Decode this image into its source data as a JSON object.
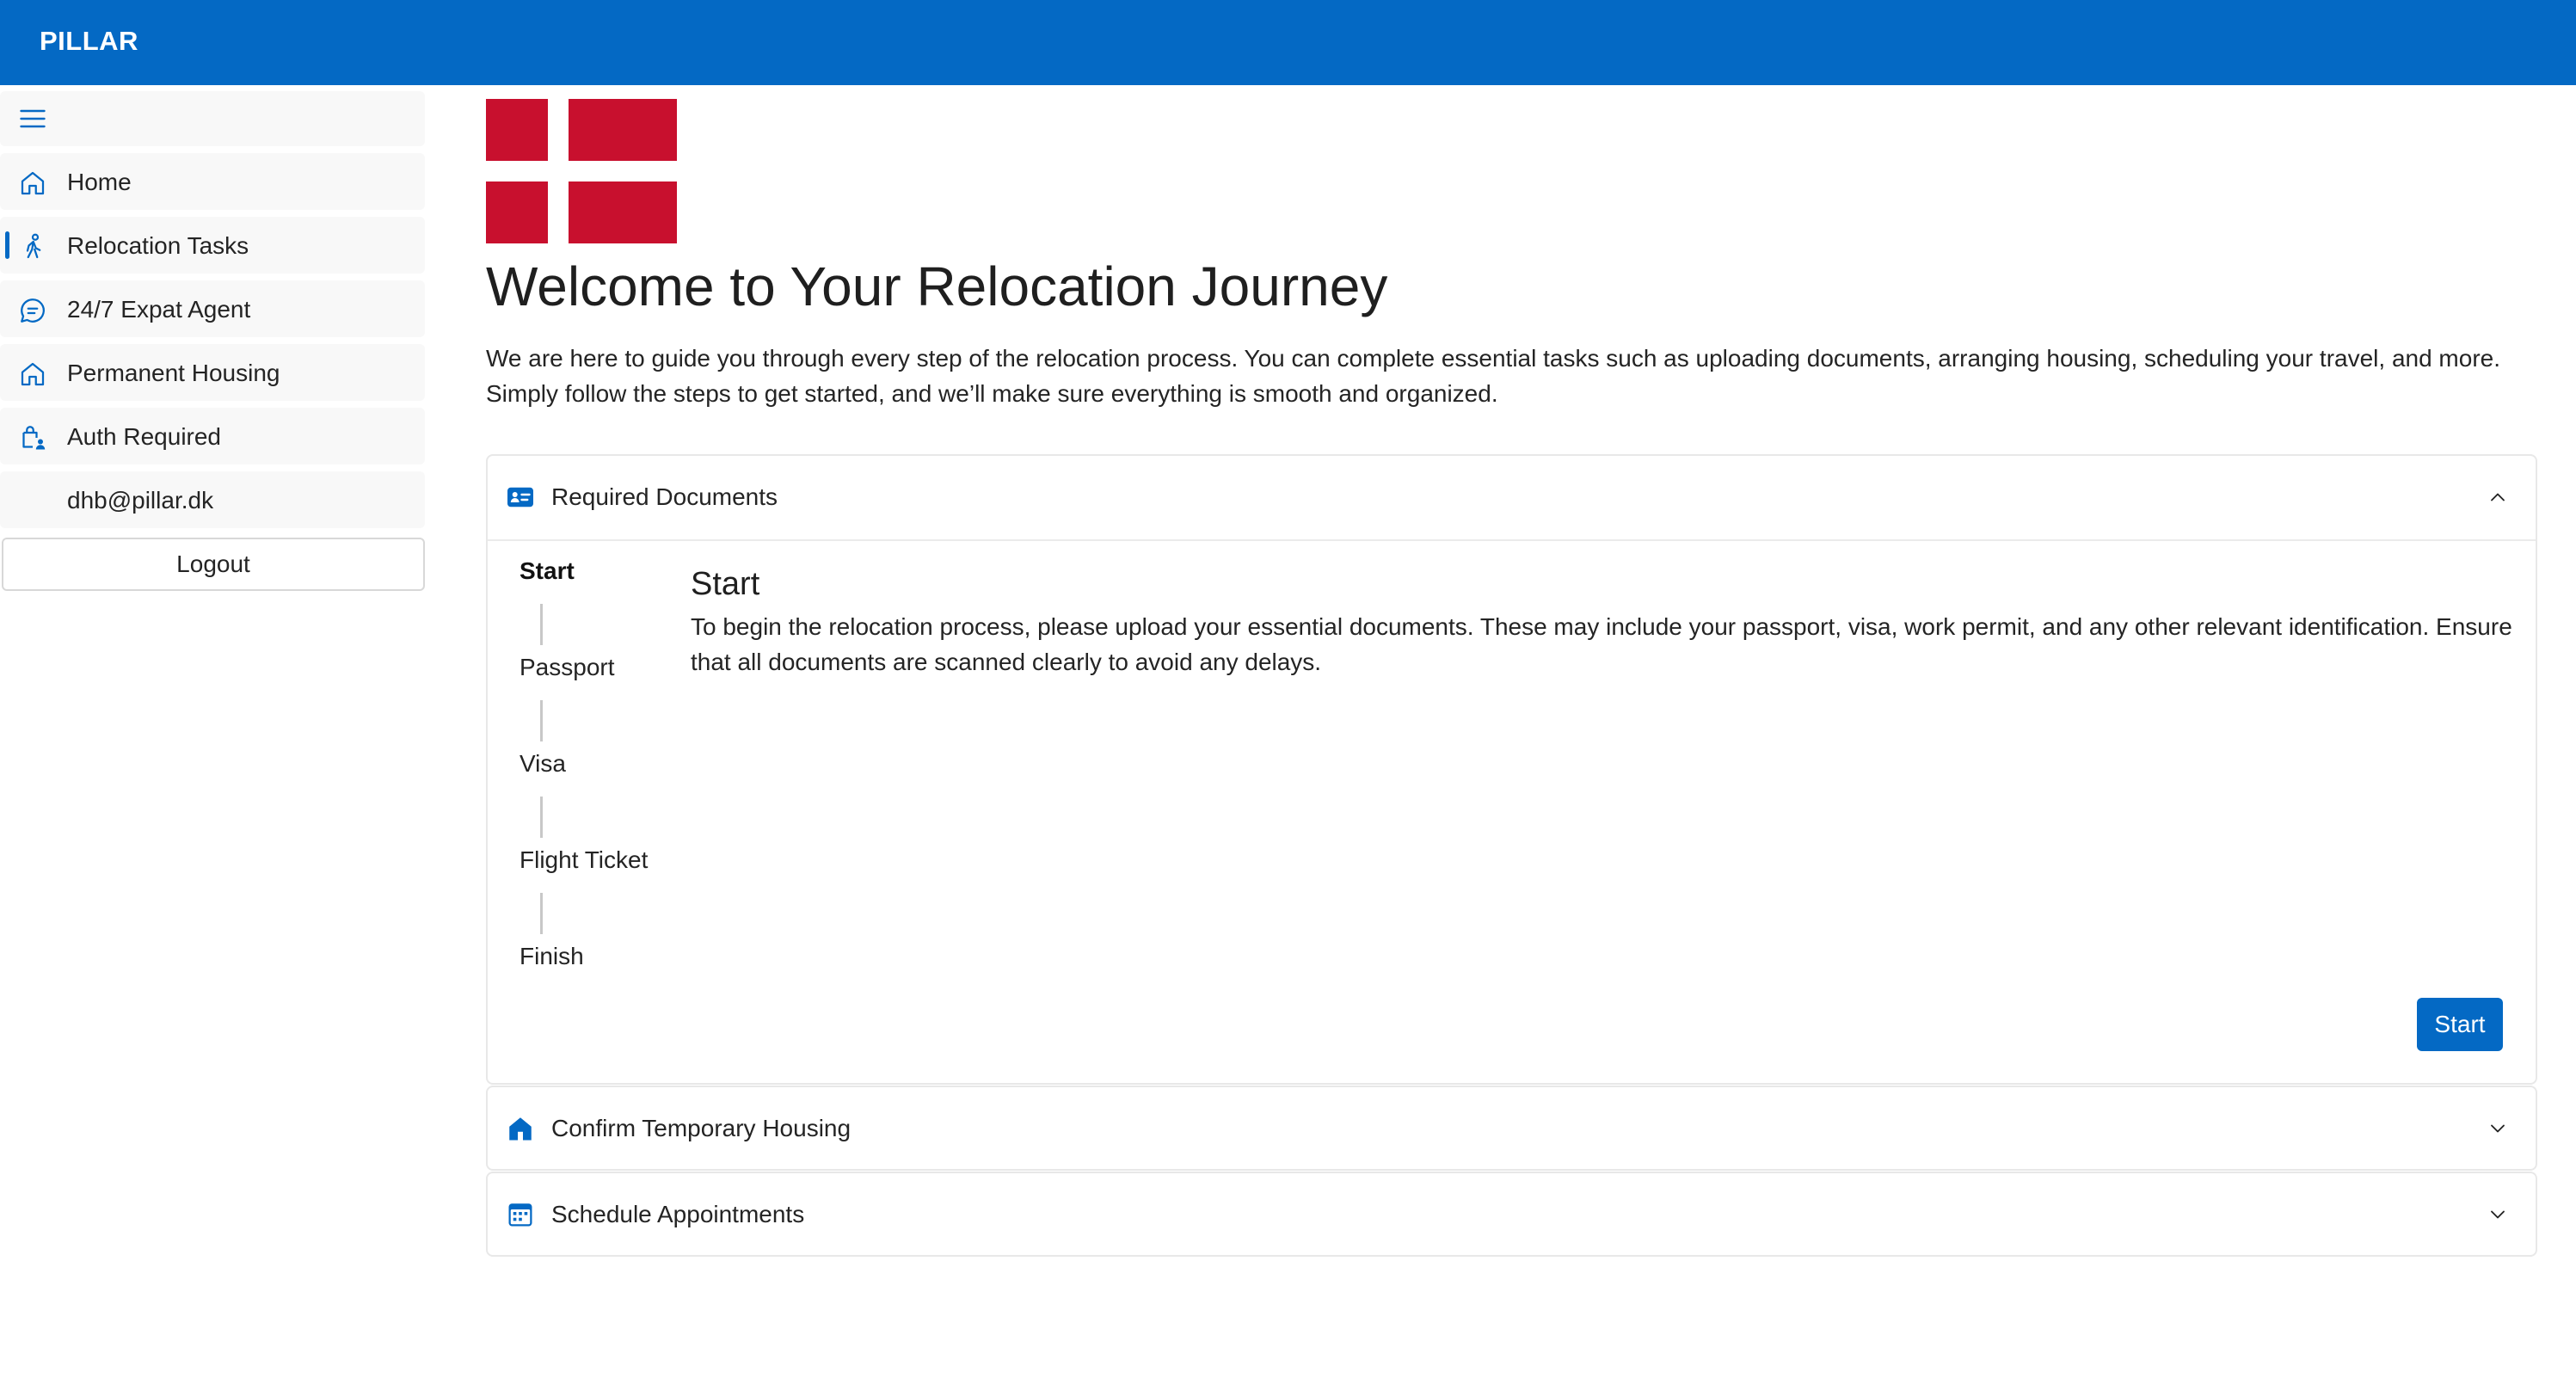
{
  "app": {
    "brand": "PILLAR"
  },
  "colors": {
    "accent": "#0469c4",
    "flag_red": "#c8102e"
  },
  "sidebar": {
    "menu_icon": "hamburger-icon",
    "items": [
      {
        "label": "Home",
        "icon": "home-icon"
      },
      {
        "label": "Relocation Tasks",
        "icon": "person-walking-icon",
        "active": true
      },
      {
        "label": "24/7 Expat Agent",
        "icon": "chat-icon"
      },
      {
        "label": "Permanent Housing",
        "icon": "house-icon"
      },
      {
        "label": "Auth Required",
        "icon": "lock-person-icon"
      },
      {
        "label": "dhb@pillar.dk"
      }
    ],
    "logout_label": "Logout"
  },
  "main": {
    "flag_icon": "denmark-flag",
    "title": "Welcome to Your Relocation Journey",
    "intro": "We are here to guide you through every step of the relocation process. You can complete essential tasks such as uploading documents, arranging housing, scheduling your travel, and more. Simply follow the steps to get started, and we’ll make sure everything is smooth and organized."
  },
  "accordions": [
    {
      "title": "Required Documents",
      "icon": "id-card-icon",
      "expanded": true,
      "steps": [
        "Start",
        "Passport",
        "Visa",
        "Flight Ticket",
        "Finish"
      ],
      "active_step": "Start",
      "content_title": "Start",
      "content_text": "To begin the relocation process, please upload your essential documents. These may include your passport, visa, work permit, and any other relevant identification. Ensure that all documents are scanned clearly to avoid any delays.",
      "button_label": "Start"
    },
    {
      "title": "Confirm Temporary Housing",
      "icon": "home-filled-icon",
      "expanded": false
    },
    {
      "title": "Schedule Appointments",
      "icon": "calendar-icon",
      "expanded": false
    }
  ]
}
